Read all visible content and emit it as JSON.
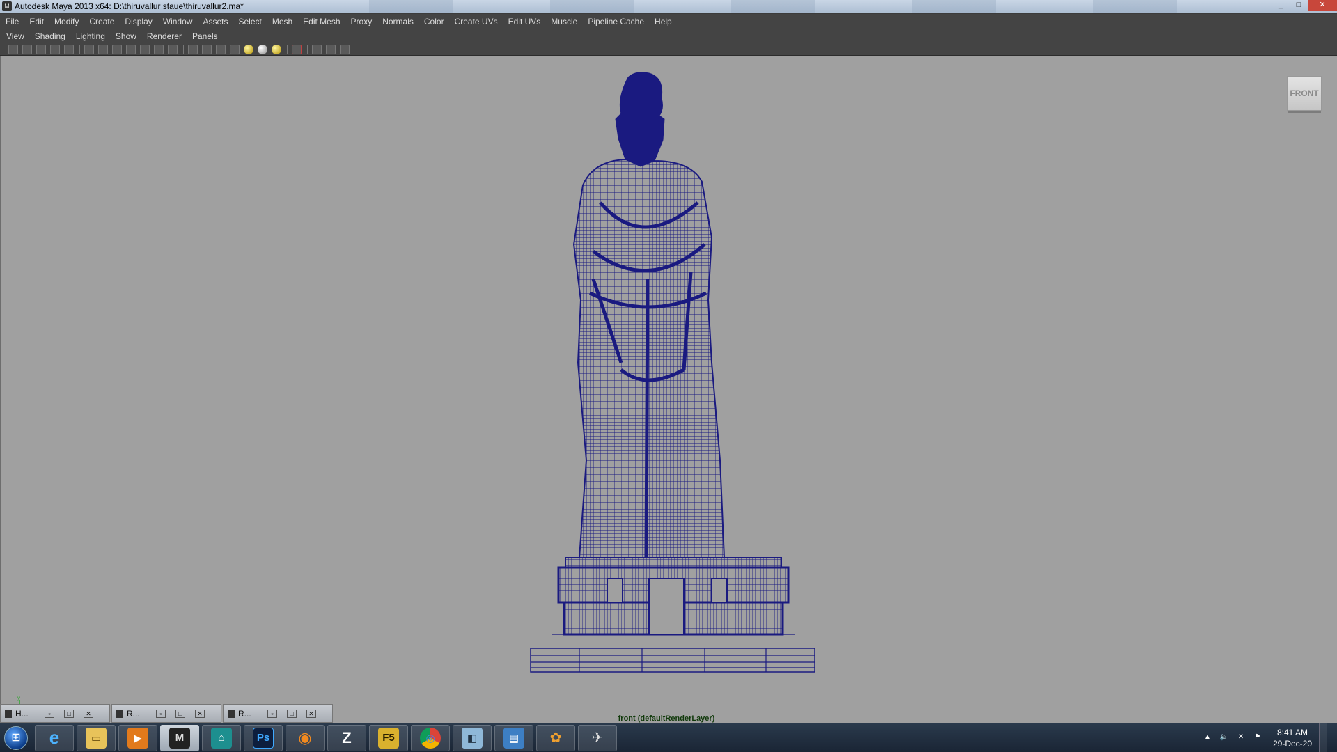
{
  "window": {
    "title": "Autodesk Maya 2013 x64: D:\\thiruvallur staue\\thiruvallur2.ma*"
  },
  "menubar": [
    "File",
    "Edit",
    "Modify",
    "Create",
    "Display",
    "Window",
    "Assets",
    "Select",
    "Mesh",
    "Edit Mesh",
    "Proxy",
    "Normals",
    "Color",
    "Create UVs",
    "Edit UVs",
    "Muscle",
    "Pipeline Cache",
    "Help"
  ],
  "panel_menu": [
    "View",
    "Shading",
    "Lighting",
    "Show",
    "Renderer",
    "Panels"
  ],
  "viewport": {
    "viewcube_label": "FRONT",
    "camera_label": "front (defaultRenderLayer)",
    "wire_color": "#1a1a80",
    "background": "#a0a0a0"
  },
  "minimized_windows": [
    {
      "label": "H...",
      "icon": "maya-window-icon"
    },
    {
      "label": "R...",
      "icon": "maya-window-icon"
    },
    {
      "label": "R...",
      "icon": "maya-window-icon"
    }
  ],
  "taskbar": {
    "apps": [
      {
        "name": "internet-explorer",
        "glyph": "e"
      },
      {
        "name": "file-explorer",
        "glyph": "▭"
      },
      {
        "name": "media-player",
        "glyph": "▶"
      },
      {
        "name": "maya",
        "glyph": "M"
      },
      {
        "name": "maya-app",
        "glyph": "⌂"
      },
      {
        "name": "photoshop",
        "glyph": "Ps"
      },
      {
        "name": "blender",
        "glyph": "◉"
      },
      {
        "name": "zbrush",
        "glyph": "Z"
      },
      {
        "name": "f5",
        "glyph": "F5"
      },
      {
        "name": "chrome",
        "glyph": "◎"
      },
      {
        "name": "app-blue",
        "glyph": "◧"
      },
      {
        "name": "window-app",
        "glyph": "▤"
      },
      {
        "name": "paw-app",
        "glyph": "✿"
      },
      {
        "name": "tool-app",
        "glyph": "✈"
      }
    ],
    "time": "8:41 AM",
    "date": "29-Dec-20"
  }
}
